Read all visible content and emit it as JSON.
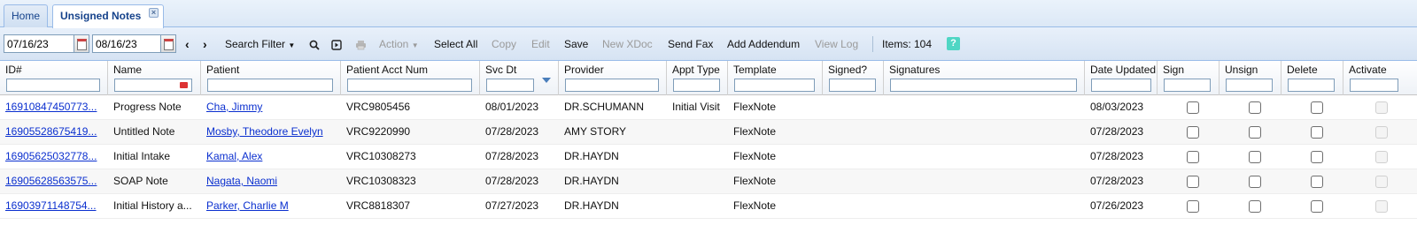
{
  "tabs": {
    "home": "Home",
    "active": "Unsigned Notes"
  },
  "toolbar": {
    "date_from": "07/16/23",
    "date_to": "08/16/23",
    "search_filter": "Search Filter",
    "action": "Action",
    "select_all": "Select All",
    "copy": "Copy",
    "edit": "Edit",
    "save": "Save",
    "new_xdoc": "New XDoc",
    "send_fax": "Send Fax",
    "add_addendum": "Add Addendum",
    "view_log": "View Log",
    "items": "Items: 104",
    "help": "?"
  },
  "columns": {
    "id": "ID#",
    "name": "Name",
    "patient": "Patient",
    "acct": "Patient Acct Num",
    "svc": "Svc Dt",
    "provider": "Provider",
    "appt": "Appt Type",
    "template": "Template",
    "signed": "Signed?",
    "signatures": "Signatures",
    "updated": "Date Updated",
    "sign": "Sign",
    "unsign": "Unsign",
    "delete": "Delete",
    "activate": "Activate"
  },
  "rows": [
    {
      "id": "16910847450773...",
      "name": "Progress Note",
      "patient": "Cha, Jimmy",
      "acct": "VRC9805456",
      "svc": "08/01/2023",
      "provider": "DR.SCHUMANN",
      "appt": "Initial Visit",
      "template": "FlexNote",
      "signed": "",
      "signatures": "",
      "updated": "08/03/2023"
    },
    {
      "id": "16905528675419...",
      "name": "Untitled Note",
      "patient": "Mosby, Theodore Evelyn",
      "acct": "VRC9220990",
      "svc": "07/28/2023",
      "provider": "AMY STORY",
      "appt": "",
      "template": "FlexNote",
      "signed": "",
      "signatures": "",
      "updated": "07/28/2023"
    },
    {
      "id": "16905625032778...",
      "name": "Initial Intake",
      "patient": "Kamal, Alex",
      "acct": "VRC10308273",
      "svc": "07/28/2023",
      "provider": "DR.HAYDN",
      "appt": "",
      "template": "FlexNote",
      "signed": "",
      "signatures": "",
      "updated": "07/28/2023"
    },
    {
      "id": "16905628563575...",
      "name": "SOAP Note",
      "patient": "Nagata, Naomi",
      "acct": "VRC10308323",
      "svc": "07/28/2023",
      "provider": "DR.HAYDN",
      "appt": "",
      "template": "FlexNote",
      "signed": "",
      "signatures": "",
      "updated": "07/28/2023"
    },
    {
      "id": "16903971148754...",
      "name": "Initial History a...",
      "patient": "Parker, Charlie M",
      "acct": "VRC8818307",
      "svc": "07/27/2023",
      "provider": "DR.HAYDN",
      "appt": "",
      "template": "FlexNote",
      "signed": "",
      "signatures": "",
      "updated": "07/26/2023"
    }
  ]
}
